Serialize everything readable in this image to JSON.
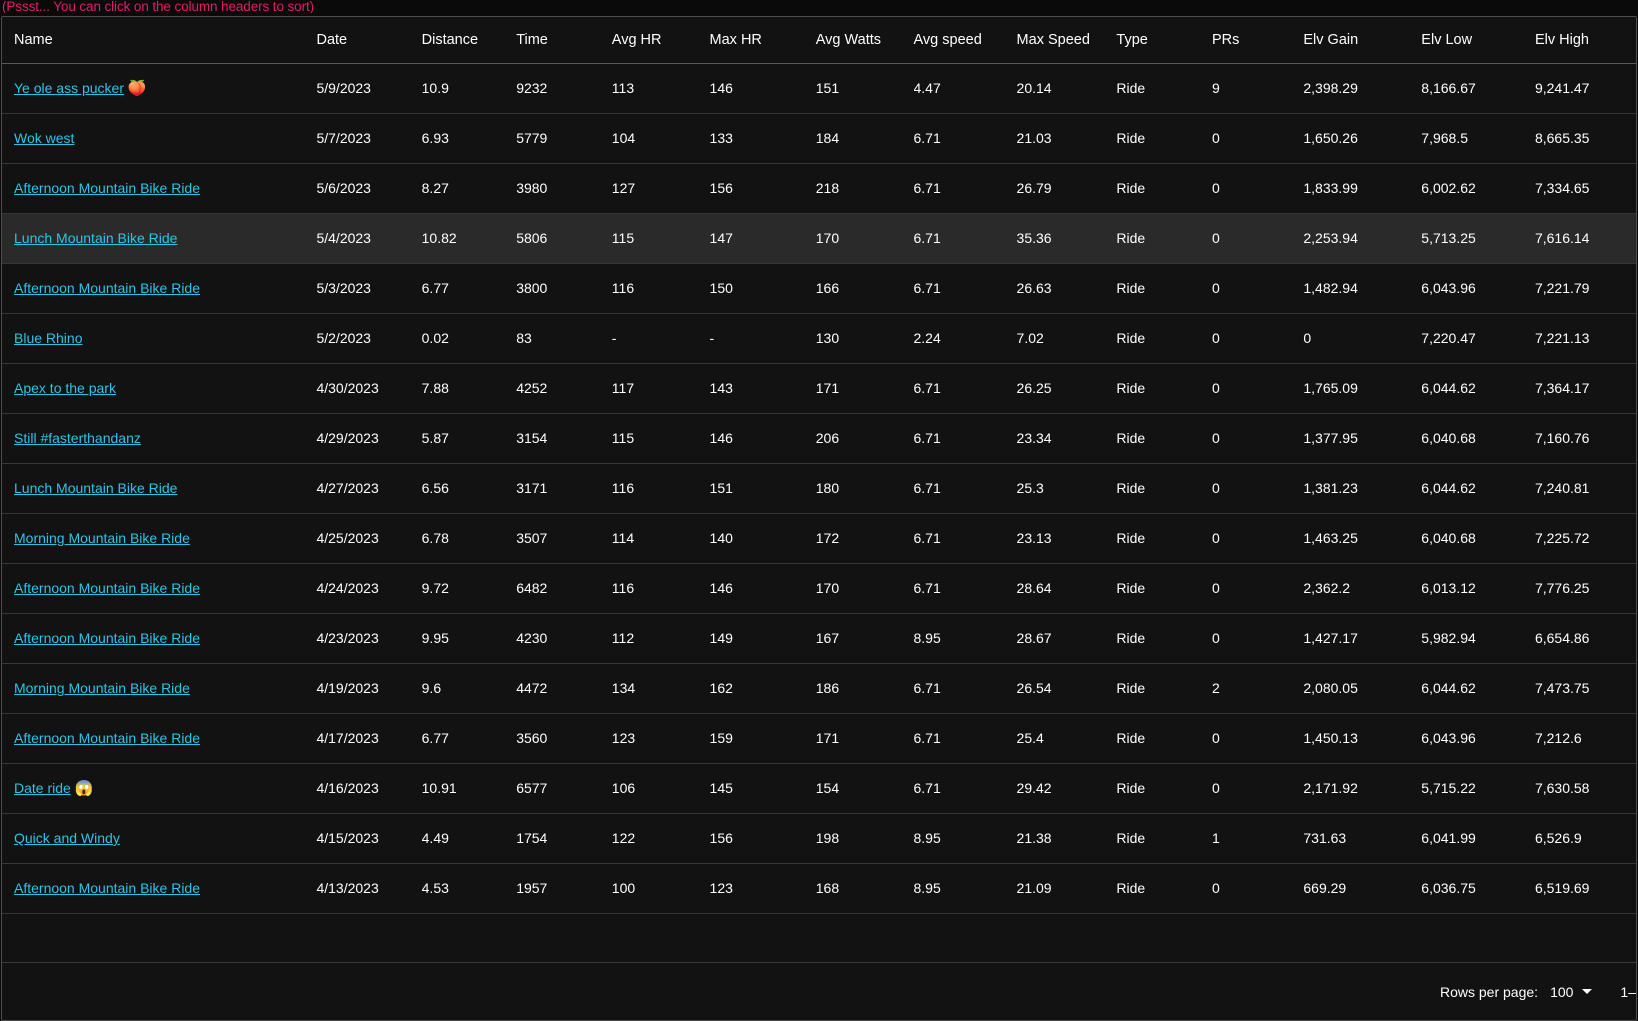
{
  "hint": "(Pssst... You can click on the column headers to sort)",
  "colors": {
    "hint_pink": "#e61a6b",
    "link_cyan": "#29c5e8",
    "page_bg": "#0a0a0a",
    "card_bg": "#121212",
    "row_hover_bg": "#2a2a2a",
    "row_divider": "#363636",
    "text": "#ffffff"
  },
  "table": {
    "columns": [
      {
        "key": "name",
        "label": "Name"
      },
      {
        "key": "date",
        "label": "Date"
      },
      {
        "key": "dist",
        "label": "Distance"
      },
      {
        "key": "time",
        "label": "Time"
      },
      {
        "key": "ahr",
        "label": "Avg HR"
      },
      {
        "key": "mhr",
        "label": "Max HR"
      },
      {
        "key": "watts",
        "label": "Avg Watts"
      },
      {
        "key": "aspeed",
        "label": "Avg speed"
      },
      {
        "key": "mspeed",
        "label": "Max Speed"
      },
      {
        "key": "type",
        "label": "Type"
      },
      {
        "key": "prs",
        "label": "PRs"
      },
      {
        "key": "egain",
        "label": "Elv Gain"
      },
      {
        "key": "elow",
        "label": "Elv Low"
      },
      {
        "key": "ehigh",
        "label": "Elv High"
      }
    ],
    "rows": [
      {
        "name": "Ye ole ass pucker",
        "emoji": "🍑",
        "date": "5/9/2023",
        "dist": "10.9",
        "time": "9232",
        "ahr": "113",
        "mhr": "146",
        "watts": "151",
        "aspeed": "4.47",
        "mspeed": "20.14",
        "type": "Ride",
        "prs": "9",
        "egain": "2,398.29",
        "elow": "8,166.67",
        "ehigh": "9,241.47",
        "hover": false
      },
      {
        "name": "Wok west",
        "emoji": "",
        "date": "5/7/2023",
        "dist": "6.93",
        "time": "5779",
        "ahr": "104",
        "mhr": "133",
        "watts": "184",
        "aspeed": "6.71",
        "mspeed": "21.03",
        "type": "Ride",
        "prs": "0",
        "egain": "1,650.26",
        "elow": "7,968.5",
        "ehigh": "8,665.35",
        "hover": false
      },
      {
        "name": "Afternoon Mountain Bike Ride",
        "emoji": "",
        "date": "5/6/2023",
        "dist": "8.27",
        "time": "3980",
        "ahr": "127",
        "mhr": "156",
        "watts": "218",
        "aspeed": "6.71",
        "mspeed": "26.79",
        "type": "Ride",
        "prs": "0",
        "egain": "1,833.99",
        "elow": "6,002.62",
        "ehigh": "7,334.65",
        "hover": false
      },
      {
        "name": "Lunch Mountain Bike Ride",
        "emoji": "",
        "date": "5/4/2023",
        "dist": "10.82",
        "time": "5806",
        "ahr": "115",
        "mhr": "147",
        "watts": "170",
        "aspeed": "6.71",
        "mspeed": "35.36",
        "type": "Ride",
        "prs": "0",
        "egain": "2,253.94",
        "elow": "5,713.25",
        "ehigh": "7,616.14",
        "hover": true
      },
      {
        "name": "Afternoon Mountain Bike Ride",
        "emoji": "",
        "date": "5/3/2023",
        "dist": "6.77",
        "time": "3800",
        "ahr": "116",
        "mhr": "150",
        "watts": "166",
        "aspeed": "6.71",
        "mspeed": "26.63",
        "type": "Ride",
        "prs": "0",
        "egain": "1,482.94",
        "elow": "6,043.96",
        "ehigh": "7,221.79",
        "hover": false
      },
      {
        "name": "Blue Rhino",
        "emoji": "",
        "date": "5/2/2023",
        "dist": "0.02",
        "time": "83",
        "ahr": "-",
        "mhr": "-",
        "watts": "130",
        "aspeed": "2.24",
        "mspeed": "7.02",
        "type": "Ride",
        "prs": "0",
        "egain": "0",
        "elow": "7,220.47",
        "ehigh": "7,221.13",
        "hover": false
      },
      {
        "name": "Apex to the park",
        "emoji": "",
        "date": "4/30/2023",
        "dist": "7.88",
        "time": "4252",
        "ahr": "117",
        "mhr": "143",
        "watts": "171",
        "aspeed": "6.71",
        "mspeed": "26.25",
        "type": "Ride",
        "prs": "0",
        "egain": "1,765.09",
        "elow": "6,044.62",
        "ehigh": "7,364.17",
        "hover": false
      },
      {
        "name": "Still #fasterthandanz",
        "emoji": "",
        "date": "4/29/2023",
        "dist": "5.87",
        "time": "3154",
        "ahr": "115",
        "mhr": "146",
        "watts": "206",
        "aspeed": "6.71",
        "mspeed": "23.34",
        "type": "Ride",
        "prs": "0",
        "egain": "1,377.95",
        "elow": "6,040.68",
        "ehigh": "7,160.76",
        "hover": false
      },
      {
        "name": "Lunch Mountain Bike Ride",
        "emoji": "",
        "date": "4/27/2023",
        "dist": "6.56",
        "time": "3171",
        "ahr": "116",
        "mhr": "151",
        "watts": "180",
        "aspeed": "6.71",
        "mspeed": "25.3",
        "type": "Ride",
        "prs": "0",
        "egain": "1,381.23",
        "elow": "6,044.62",
        "ehigh": "7,240.81",
        "hover": false
      },
      {
        "name": "Morning Mountain Bike Ride",
        "emoji": "",
        "date": "4/25/2023",
        "dist": "6.78",
        "time": "3507",
        "ahr": "114",
        "mhr": "140",
        "watts": "172",
        "aspeed": "6.71",
        "mspeed": "23.13",
        "type": "Ride",
        "prs": "0",
        "egain": "1,463.25",
        "elow": "6,040.68",
        "ehigh": "7,225.72",
        "hover": false
      },
      {
        "name": "Afternoon Mountain Bike Ride",
        "emoji": "",
        "date": "4/24/2023",
        "dist": "9.72",
        "time": "6482",
        "ahr": "116",
        "mhr": "146",
        "watts": "170",
        "aspeed": "6.71",
        "mspeed": "28.64",
        "type": "Ride",
        "prs": "0",
        "egain": "2,362.2",
        "elow": "6,013.12",
        "ehigh": "7,776.25",
        "hover": false
      },
      {
        "name": "Afternoon Mountain Bike Ride",
        "emoji": "",
        "date": "4/23/2023",
        "dist": "9.95",
        "time": "4230",
        "ahr": "112",
        "mhr": "149",
        "watts": "167",
        "aspeed": "8.95",
        "mspeed": "28.67",
        "type": "Ride",
        "prs": "0",
        "egain": "1,427.17",
        "elow": "5,982.94",
        "ehigh": "6,654.86",
        "hover": false
      },
      {
        "name": "Morning Mountain Bike Ride",
        "emoji": "",
        "date": "4/19/2023",
        "dist": "9.6",
        "time": "4472",
        "ahr": "134",
        "mhr": "162",
        "watts": "186",
        "aspeed": "6.71",
        "mspeed": "26.54",
        "type": "Ride",
        "prs": "2",
        "egain": "2,080.05",
        "elow": "6,044.62",
        "ehigh": "7,473.75",
        "hover": false
      },
      {
        "name": "Afternoon Mountain Bike Ride",
        "emoji": "",
        "date": "4/17/2023",
        "dist": "6.77",
        "time": "3560",
        "ahr": "123",
        "mhr": "159",
        "watts": "171",
        "aspeed": "6.71",
        "mspeed": "25.4",
        "type": "Ride",
        "prs": "0",
        "egain": "1,450.13",
        "elow": "6,043.96",
        "ehigh": "7,212.6",
        "hover": false
      },
      {
        "name": "Date ride",
        "emoji": "😱",
        "date": "4/16/2023",
        "dist": "10.91",
        "time": "6577",
        "ahr": "106",
        "mhr": "145",
        "watts": "154",
        "aspeed": "6.71",
        "mspeed": "29.42",
        "type": "Ride",
        "prs": "0",
        "egain": "2,171.92",
        "elow": "5,715.22",
        "ehigh": "7,630.58",
        "hover": false
      },
      {
        "name": "Quick and Windy",
        "emoji": "",
        "date": "4/15/2023",
        "dist": "4.49",
        "time": "1754",
        "ahr": "122",
        "mhr": "156",
        "watts": "198",
        "aspeed": "8.95",
        "mspeed": "21.38",
        "type": "Ride",
        "prs": "1",
        "egain": "731.63",
        "elow": "6,041.99",
        "ehigh": "6,526.9",
        "hover": false
      },
      {
        "name": "Afternoon Mountain Bike Ride",
        "emoji": "",
        "date": "4/13/2023",
        "dist": "4.53",
        "time": "1957",
        "ahr": "100",
        "mhr": "123",
        "watts": "168",
        "aspeed": "8.95",
        "mspeed": "21.09",
        "type": "Ride",
        "prs": "0",
        "egain": "669.29",
        "elow": "6,036.75",
        "ehigh": "6,519.69",
        "hover": false
      }
    ]
  },
  "footer": {
    "rows_per_page_label": "Rows per page:",
    "rows_per_page_value": "100",
    "range_label": "1–"
  }
}
